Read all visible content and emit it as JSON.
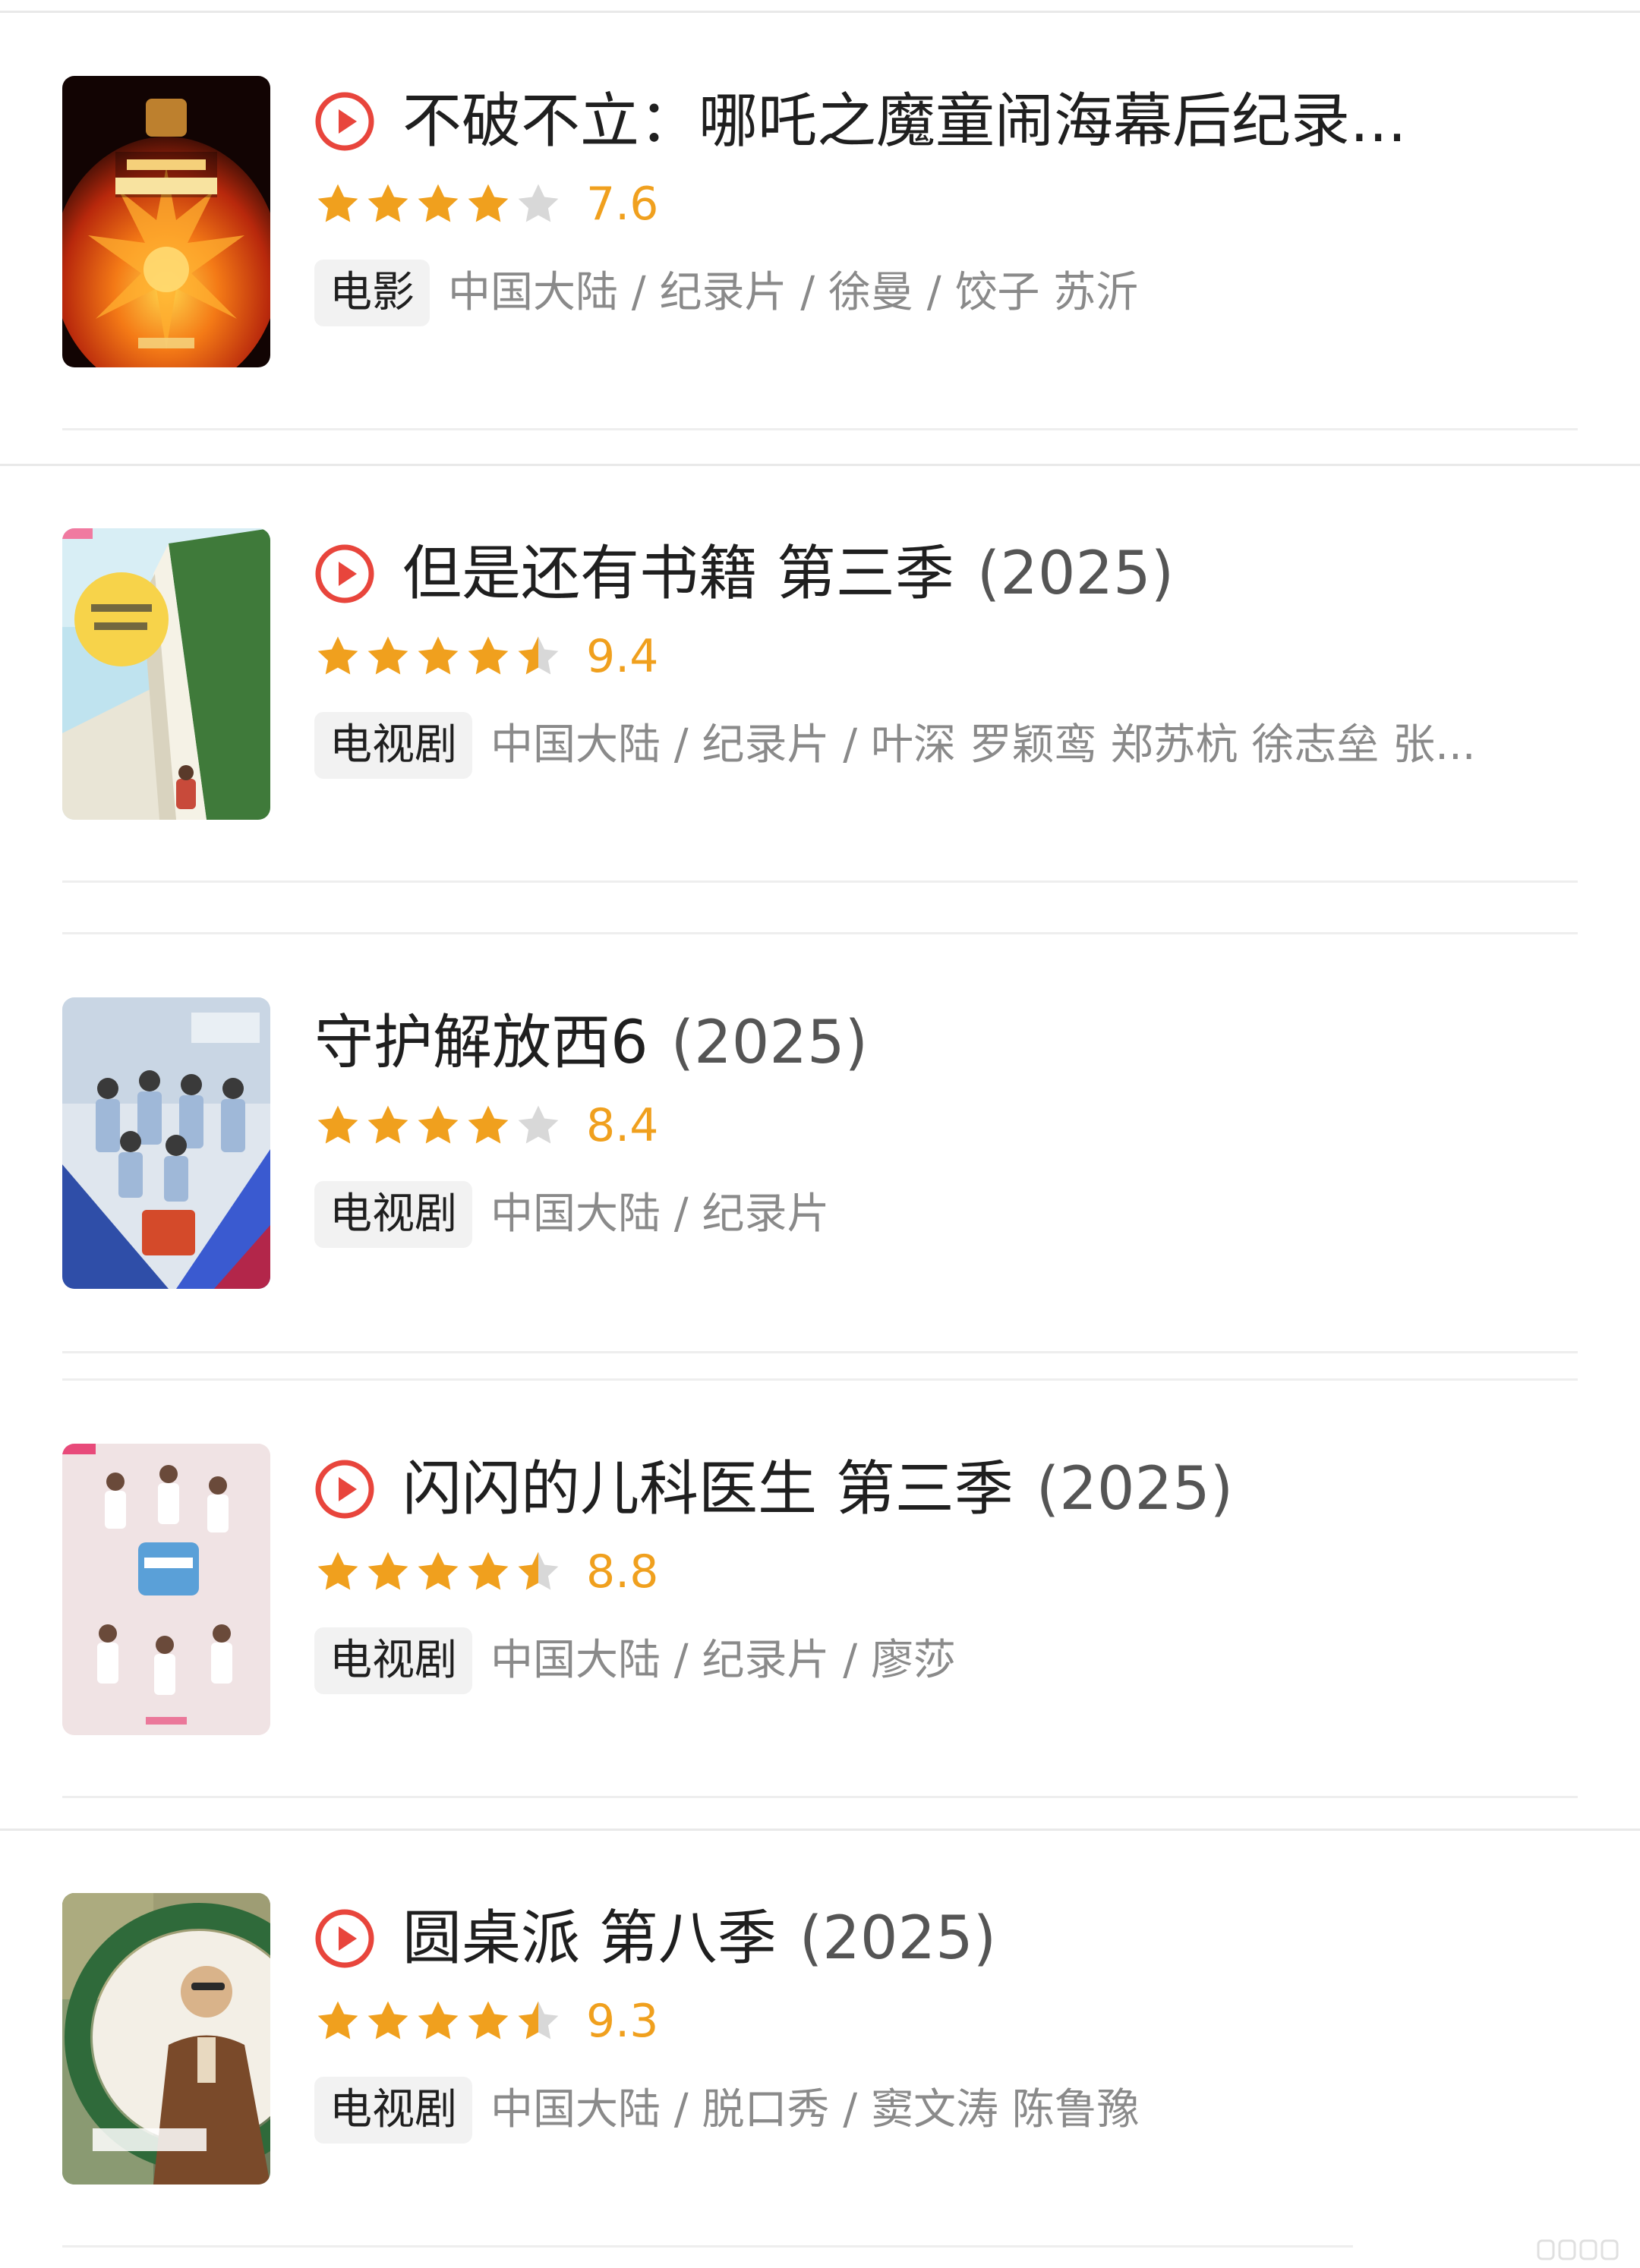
{
  "colors": {
    "accent": "#f0a01e",
    "play_icon": "#e8453c",
    "star_empty": "#d8d8d8",
    "meta_text": "#8a8a8a",
    "tag_bg": "#f2f2f2"
  },
  "items": [
    {
      "title": "不破不立：哪吒之魔童闹海幕后纪录...",
      "year": "",
      "has_play": true,
      "rating": 7.6,
      "score_text": "7.6",
      "stars": [
        "full",
        "full",
        "full",
        "full",
        "empty"
      ],
      "tag": "电影",
      "meta": "中国大陆 / 纪录片 / 徐曼 / 饺子 苏沂",
      "poster_icon": "film-poster-fiery"
    },
    {
      "title": "但是还有书籍 第三季",
      "year": "(2025)",
      "has_play": true,
      "rating": 9.4,
      "score_text": "9.4",
      "stars": [
        "full",
        "full",
        "full",
        "full",
        "half"
      ],
      "tag": "电视剧",
      "meta": "中国大陆 / 纪录片 / 叶深 罗颖鸾 郑苏杭 徐志垒 张...",
      "poster_icon": "book-poster"
    },
    {
      "title": "守护解放西6",
      "year": "(2025)",
      "has_play": false,
      "rating": 8.4,
      "score_text": "8.4",
      "stars": [
        "full",
        "full",
        "full",
        "full",
        "empty"
      ],
      "tag": "电视剧",
      "meta": "中国大陆 / 纪录片",
      "poster_icon": "police-poster"
    },
    {
      "title": "闪闪的儿科医生 第三季",
      "year": "(2025)",
      "has_play": true,
      "rating": 8.8,
      "score_text": "8.8",
      "stars": [
        "full",
        "full",
        "full",
        "full",
        "half"
      ],
      "tag": "电视剧",
      "meta": "中国大陆 / 纪录片 / 廖莎",
      "poster_icon": "doctor-poster"
    },
    {
      "title": "圆桌派 第八季",
      "year": "(2025)",
      "has_play": true,
      "rating": 9.3,
      "score_text": "9.3",
      "stars": [
        "full",
        "full",
        "full",
        "full",
        "half"
      ],
      "tag": "电视剧",
      "meta": "中国大陆 / 脱口秀 / 窦文涛 陈鲁豫",
      "poster_icon": "roundtable-poster"
    }
  ]
}
